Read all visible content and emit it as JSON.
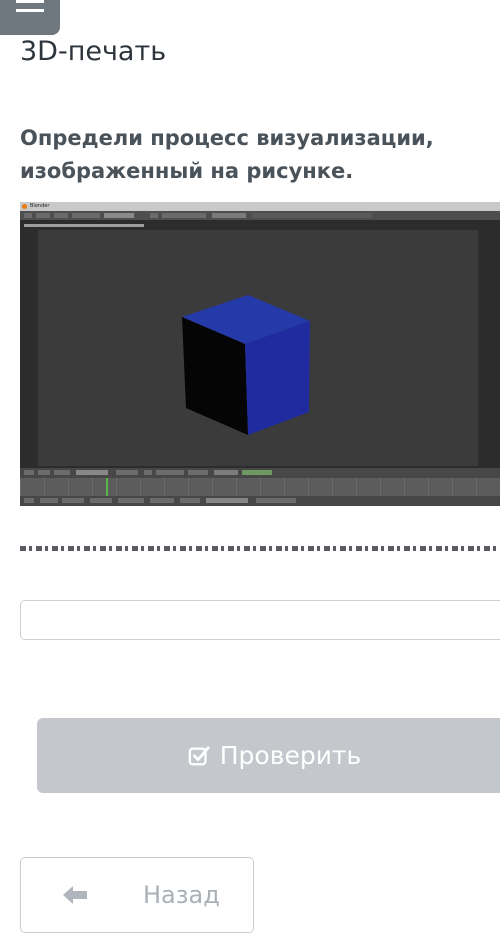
{
  "header": {
    "menu_icon": "hamburger-menu-icon",
    "section_title": "3D-печать"
  },
  "question": {
    "text": "Определи процесс визуализации, изображенный на рисунке."
  },
  "image": {
    "app": "Blender",
    "window_title": "Blender",
    "cube_color": "#1f2b9e"
  },
  "answer": {
    "value": "",
    "placeholder": ""
  },
  "actions": {
    "check_label": "Проверить",
    "check_icon": "checkbox-check-icon",
    "back_label": "Назад",
    "back_icon": "arrow-left-icon"
  },
  "colors": {
    "menu_button": "#6f777f",
    "check_button_bg": "#c4c8cc",
    "back_arrow": "#b0b6bc"
  }
}
